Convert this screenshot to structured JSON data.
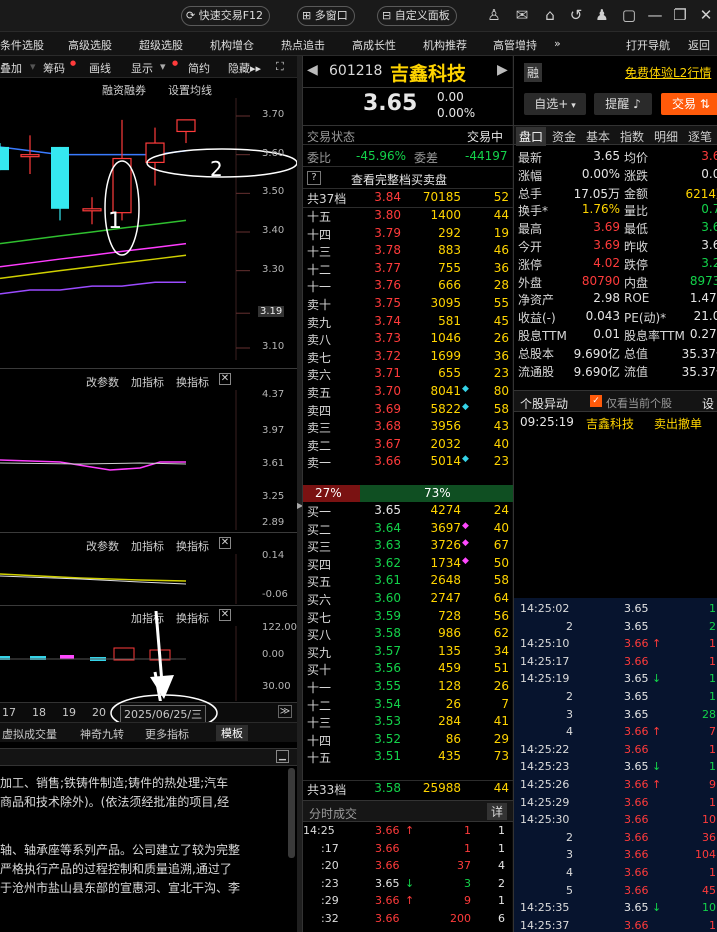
{
  "topbar": {
    "quick_trade": "快速交易F12",
    "multi_window": "多窗口",
    "custom_panel": "自定义面板"
  },
  "menu": [
    "条件选股",
    "高级选股",
    "超级选股",
    "机构增仓",
    "热点追击",
    "高成长性",
    "机构推荐",
    "高管增持",
    "»",
    "打开导航",
    "返回"
  ],
  "toolbar": {
    "add": "叠加",
    "chips": "筹码",
    "draw": "画线",
    "display": "显示",
    "simple": "简约",
    "hide": "隐藏▸▸"
  },
  "kline_header": {
    "margin": "融资融券",
    "settings": "设置均线"
  },
  "kline_ticks": [
    "3.70",
    "3.60",
    "3.50",
    "3.40",
    "3.30",
    "3.19",
    "3.10"
  ],
  "annotations": [
    "1",
    "2"
  ],
  "panel_ctrl": {
    "edit": "改参数",
    "add": "加指标",
    "switch": "换指标"
  },
  "panel1_ticks": [
    "4.37",
    "3.97",
    "3.61",
    "3.25",
    "2.89"
  ],
  "panel2_ticks": [
    "0.14",
    "-0.06"
  ],
  "panel3_ticks": [
    "122.00",
    "0.00",
    "30.00"
  ],
  "dates": [
    "17",
    "18",
    "19",
    "20"
  ],
  "date_box": "2025/06/25/三",
  "bottom_tabs": [
    "虚拟成交量",
    "神奇九转",
    "更多指标",
    "模板"
  ],
  "desc": [
    "加工、销售;铁铸件制造;铸件的热处理;汽车",
    "商品和技术除外)。(依法须经批准的项目,经",
    "轴、轴承座等系列产品。公司建立了较为完整",
    "严格执行产品的过程控制和质量追溯,通过了",
    "于沧州市盐山县东部的宣惠河、宣北干沟、李"
  ],
  "stock": {
    "code": "601218",
    "name": "吉鑫科技",
    "price": "3.65",
    "change": "0.00",
    "change_pct": "0.00%",
    "badge": "融",
    "l2": "免费体验L2行情"
  },
  "buttons": {
    "watch": "自选+",
    "alert": "提醒",
    "trade": "交易"
  },
  "status": {
    "label": "交易状态",
    "value": "交易中"
  },
  "ratio": {
    "weibi_label": "委比",
    "weibi": "-45.96%",
    "weicha_label": "委差",
    "weicha": "-44197"
  },
  "full_book": "查看完整档买卖盘",
  "sell_total": {
    "label": "共37档",
    "price": "3.84",
    "vol": "70185",
    "cnt": "52"
  },
  "sells": [
    [
      "十五",
      "3.80",
      "1400",
      "",
      "44"
    ],
    [
      "十四",
      "3.79",
      "292",
      "",
      "19"
    ],
    [
      "十三",
      "3.78",
      "883",
      "",
      "46"
    ],
    [
      "十二",
      "3.77",
      "755",
      "",
      "36"
    ],
    [
      "十一",
      "3.76",
      "666",
      "",
      "28"
    ],
    [
      "卖十",
      "3.75",
      "3095",
      "",
      "55"
    ],
    [
      "卖九",
      "3.74",
      "581",
      "",
      "45"
    ],
    [
      "卖八",
      "3.73",
      "1046",
      "",
      "26"
    ],
    [
      "卖七",
      "3.72",
      "1699",
      "",
      "36"
    ],
    [
      "卖六",
      "3.71",
      "655",
      "",
      "23"
    ],
    [
      "卖五",
      "3.70",
      "8041",
      "c",
      "80"
    ],
    [
      "卖四",
      "3.69",
      "5822",
      "c",
      "58"
    ],
    [
      "卖三",
      "3.68",
      "3956",
      "",
      "43"
    ],
    [
      "卖二",
      "3.67",
      "2032",
      "",
      "40"
    ],
    [
      "卖一",
      "3.66",
      "5014",
      "c",
      "23"
    ]
  ],
  "ratio_bar": {
    "buy": "27%",
    "sell": "73%"
  },
  "buys": [
    [
      "买一",
      "3.65",
      "4274",
      "",
      "24"
    ],
    [
      "买二",
      "3.64",
      "3697",
      "m",
      "40"
    ],
    [
      "买三",
      "3.63",
      "3726",
      "m",
      "67"
    ],
    [
      "买四",
      "3.62",
      "1734",
      "m",
      "50"
    ],
    [
      "买五",
      "3.61",
      "2648",
      "",
      "58"
    ],
    [
      "买六",
      "3.60",
      "2747",
      "",
      "64"
    ],
    [
      "买七",
      "3.59",
      "728",
      "",
      "56"
    ],
    [
      "买八",
      "3.58",
      "986",
      "",
      "62"
    ],
    [
      "买九",
      "3.57",
      "135",
      "",
      "34"
    ],
    [
      "买十",
      "3.56",
      "459",
      "",
      "51"
    ],
    [
      "十一",
      "3.55",
      "128",
      "",
      "26"
    ],
    [
      "十二",
      "3.54",
      "26",
      "",
      "7"
    ],
    [
      "十三",
      "3.53",
      "284",
      "",
      "41"
    ],
    [
      "十四",
      "3.52",
      "86",
      "",
      "29"
    ],
    [
      "十五",
      "3.51",
      "435",
      "",
      "73"
    ]
  ],
  "buy_total": {
    "label": "共33档",
    "price": "3.58",
    "vol": "25988",
    "cnt": "44"
  },
  "tape": {
    "title": "分时成交",
    "detail": "详",
    "rows": [
      [
        "14:25",
        "3.66",
        "↑",
        "1",
        "1"
      ],
      [
        ":17",
        "3.66",
        "",
        "1",
        "1"
      ],
      [
        ":20",
        "3.66",
        "",
        "37",
        "4"
      ],
      [
        ":23",
        "3.65",
        "↓",
        "3",
        "2"
      ],
      [
        ":29",
        "3.66",
        "↑",
        "9",
        "1"
      ],
      [
        ":32",
        "3.66",
        "",
        "200",
        "6"
      ]
    ]
  },
  "tabs": [
    "盘口",
    "资金",
    "基本",
    "指数",
    "明细",
    "逐笔"
  ],
  "quote": [
    [
      "最新",
      "3.65",
      "w",
      "均价",
      "3.64",
      "r"
    ],
    [
      "涨幅",
      "0.00%",
      "w",
      "涨跌",
      "0.00",
      "w"
    ],
    [
      "总手",
      "17.05万",
      "w",
      "金额",
      "6214万",
      "y"
    ],
    [
      "换手*",
      "1.76%",
      "y",
      "量比",
      "0.79",
      "g"
    ],
    [
      "最高",
      "3.69",
      "r",
      "最低",
      "3.62",
      "g"
    ],
    [
      "今开",
      "3.69",
      "r",
      "昨收",
      "3.65",
      "w"
    ],
    [
      "涨停",
      "4.02",
      "r",
      "跌停",
      "3.29",
      "g"
    ],
    [
      "外盘",
      "80790",
      "r",
      "内盘",
      "89732",
      "g"
    ],
    [
      "净资产",
      "2.98",
      "w",
      "ROE",
      "1.47%",
      "w"
    ],
    [
      "收益(-)",
      "0.043",
      "w",
      "PE(动)*",
      "21.05",
      "w"
    ],
    [
      "股息TTM",
      "0.01",
      "w",
      "股息率TTM",
      "0.27%",
      "w"
    ],
    [
      "总股本",
      "9.690亿",
      "w",
      "总值",
      "35.37亿",
      "w"
    ],
    [
      "流通股",
      "9.690亿",
      "w",
      "流值",
      "35.37亿",
      "w"
    ]
  ],
  "abnormal": {
    "title": "个股异动",
    "check": "仅看当前个股",
    "settings": "设",
    "time": "09:25:19",
    "name": "吉鑫科技",
    "event": "卖出撤单"
  },
  "trades": [
    [
      "14:25:02",
      "3.65",
      "",
      "1",
      "w"
    ],
    [
      "2",
      "3.65",
      "",
      "2",
      "w"
    ],
    [
      "14:25:10",
      "3.66",
      "↑",
      "1",
      "r"
    ],
    [
      "14:25:17",
      "3.66",
      "",
      "1",
      "r"
    ],
    [
      "14:25:19",
      "3.65",
      "↓",
      "1",
      "w"
    ],
    [
      "2",
      "3.65",
      "",
      "1",
      "w"
    ],
    [
      "3",
      "3.65",
      "",
      "28",
      "w"
    ],
    [
      "4",
      "3.66",
      "↑",
      "7",
      "r"
    ],
    [
      "14:25:22",
      "3.66",
      "",
      "1",
      "r"
    ],
    [
      "14:25:23",
      "3.65",
      "↓",
      "1",
      "w"
    ],
    [
      "14:25:26",
      "3.66",
      "↑",
      "9",
      "r"
    ],
    [
      "14:25:29",
      "3.66",
      "",
      "1",
      "r"
    ],
    [
      "14:25:30",
      "3.66",
      "",
      "10",
      "r"
    ],
    [
      "2",
      "3.66",
      "",
      "36",
      "r"
    ],
    [
      "3",
      "3.66",
      "",
      "104",
      "r"
    ],
    [
      "4",
      "3.66",
      "",
      "1",
      "r"
    ],
    [
      "5",
      "3.66",
      "",
      "45",
      "r"
    ],
    [
      "14:25:35",
      "3.65",
      "↓",
      "10",
      "w"
    ],
    [
      "14:25:37",
      "3.66",
      "",
      "1",
      "r"
    ]
  ],
  "chart_data": {
    "type": "candlestick",
    "ylim": [
      3.1,
      3.7
    ],
    "candles": [
      {
        "o": 3.62,
        "h": 3.63,
        "l": 3.56,
        "c": 3.56
      },
      {
        "o": 3.6,
        "h": 3.65,
        "l": 3.55,
        "c": 3.6
      },
      {
        "o": 3.62,
        "h": 3.62,
        "l": 3.43,
        "c": 3.46
      },
      {
        "o": 3.46,
        "h": 3.49,
        "l": 3.42,
        "c": 3.46
      },
      {
        "o": 3.45,
        "h": 3.69,
        "l": 3.43,
        "c": 3.59
      },
      {
        "o": 3.58,
        "h": 3.67,
        "l": 3.52,
        "c": 3.63
      },
      {
        "o": 3.66,
        "h": 3.69,
        "l": 3.63,
        "c": 3.69
      }
    ],
    "ma_lines": [
      {
        "color": "#3a7bff",
        "values": [
          3.62,
          3.61,
          3.6,
          3.6,
          3.6,
          3.6,
          3.61
        ]
      },
      {
        "color": "#2fbf2f",
        "values": [
          3.37,
          3.38,
          3.39,
          3.4,
          3.41,
          3.42,
          3.43
        ]
      },
      {
        "color": "#ff3cff",
        "values": [
          3.31,
          3.32,
          3.33,
          3.34,
          3.35,
          3.36,
          3.37
        ]
      },
      {
        "color": "#d0d000",
        "values": [
          3.28,
          3.29,
          3.3,
          3.31,
          3.32,
          3.33,
          3.34
        ]
      },
      {
        "color": "#9b4bff",
        "values": [
          3.24,
          3.25,
          3.25,
          3.26,
          3.26,
          3.27,
          3.27
        ]
      }
    ]
  }
}
